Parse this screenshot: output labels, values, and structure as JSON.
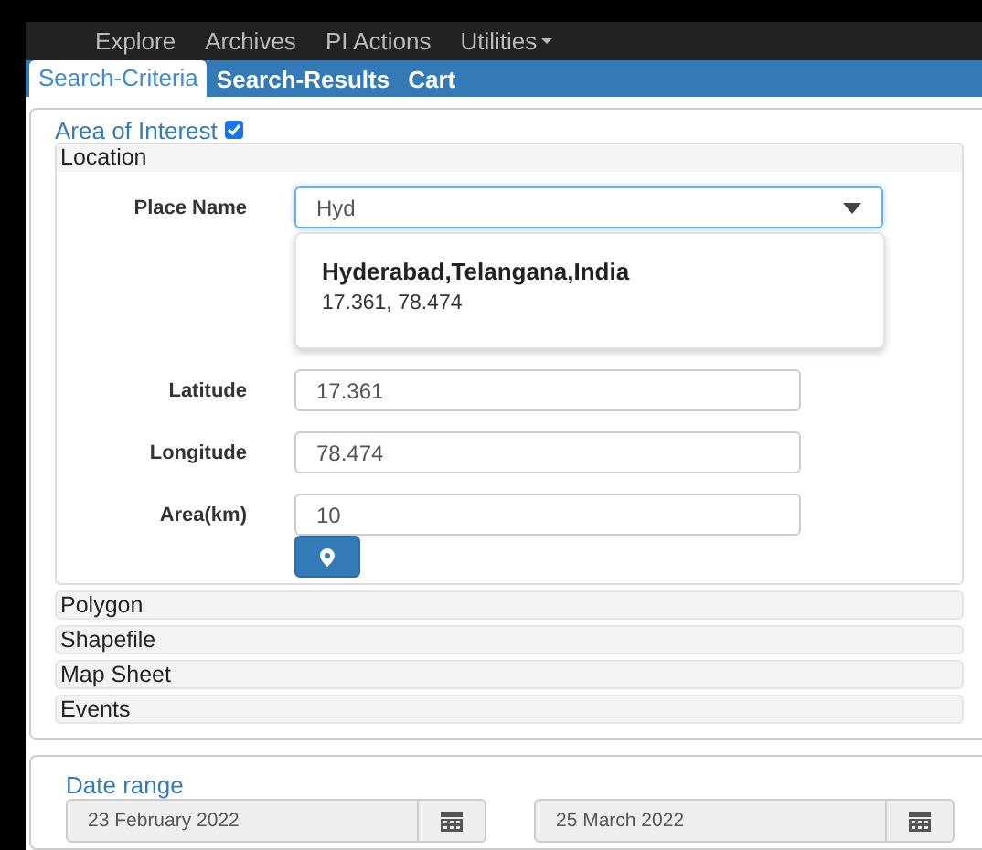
{
  "navbar": {
    "items": [
      {
        "label": "Explore",
        "has_menu": false
      },
      {
        "label": "Archives",
        "has_menu": false
      },
      {
        "label": "PI Actions",
        "has_menu": false
      },
      {
        "label": "Utilities",
        "has_menu": true
      }
    ]
  },
  "tabs": [
    {
      "label": "Search-Criteria",
      "selected": true
    },
    {
      "label": "Search-Results",
      "selected": false
    },
    {
      "label": "Cart",
      "selected": false
    }
  ],
  "area_of_interest": {
    "title": "Area of Interest",
    "checked": true,
    "location": {
      "title": "Location",
      "place_name": {
        "label": "Place Name",
        "value": "Hyd"
      },
      "suggestion": {
        "name": "Hyderabad,Telangana,India",
        "coords": "17.361, 78.474"
      },
      "fields": [
        {
          "label": "Latitude",
          "value": "17.361"
        },
        {
          "label": "Longitude",
          "value": "78.474"
        },
        {
          "label": "Area(km)",
          "value": "10"
        }
      ]
    },
    "sections": [
      {
        "title": "Polygon"
      },
      {
        "title": "Shapefile"
      },
      {
        "title": "Map Sheet"
      },
      {
        "title": "Events"
      }
    ]
  },
  "date_range": {
    "title": "Date range",
    "from": "23 February 2022",
    "to": "25 March 2022"
  }
}
